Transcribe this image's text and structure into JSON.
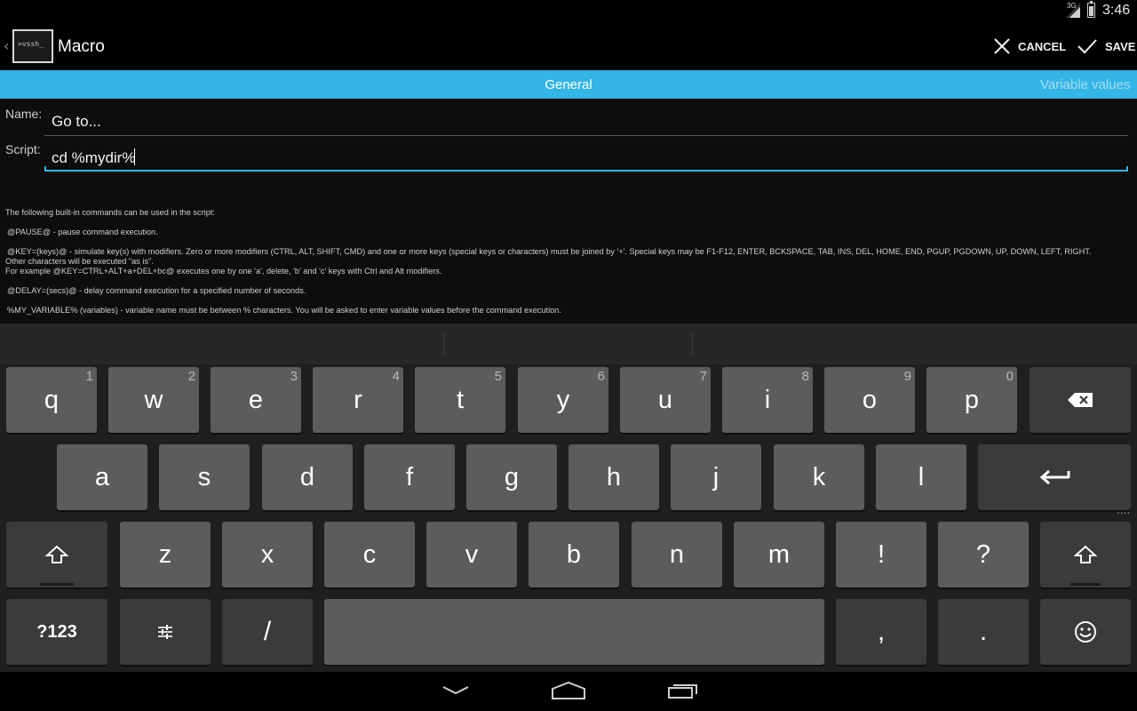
{
  "status_bar": {
    "network_label": "3G",
    "time": "3:46"
  },
  "action_bar": {
    "app_icon_text": ">vssh_",
    "title": "Macro",
    "cancel_label": "CANCEL",
    "save_label": "SAVE"
  },
  "tabs": {
    "general": "General",
    "variable_values": "Variable values"
  },
  "form": {
    "name_label": "Name:",
    "name_value": "Go to...",
    "script_label": "Script:",
    "script_value": "cd %mydir%"
  },
  "help": {
    "intro": "The following built-in commands can be used in the script:",
    "pause": "@PAUSE@ - pause command execution.",
    "key_line1": "@KEY=(keys)@ - simulate key(s) with modifiers. Zero or more modifiers (CTRL, ALT, SHIFT, CMD) and one or more keys (special keys or characters) must be joined by '+'. Special keys may be F1-F12, ENTER, BCKSPACE, TAB, INS, DEL, HOME, END, PGUP, PGDOWN, UP, DOWN, LEFT, RIGHT.",
    "key_line2": "Other characters will be executed \"as is\".",
    "key_line3": "For example @KEY=CTRL+ALT+a+DEL+bc@ executes one by one 'a', delete, 'b' and 'c' keys with Ctrl and Alt modifiers.",
    "delay": "@DELAY=(secs)@ - delay command execution for a specified number of seconds.",
    "variable": "%MY_VARIABLE% (variables) - variable name must be between % characters. You will be asked to enter variable values before the command execution."
  },
  "keyboard": {
    "row1": [
      {
        "label": "q",
        "hint": "1"
      },
      {
        "label": "w",
        "hint": "2"
      },
      {
        "label": "e",
        "hint": "3"
      },
      {
        "label": "r",
        "hint": "4"
      },
      {
        "label": "t",
        "hint": "5"
      },
      {
        "label": "y",
        "hint": "6"
      },
      {
        "label": "u",
        "hint": "7"
      },
      {
        "label": "i",
        "hint": "8"
      },
      {
        "label": "o",
        "hint": "9"
      },
      {
        "label": "p",
        "hint": "0"
      }
    ],
    "row2": [
      "a",
      "s",
      "d",
      "f",
      "g",
      "h",
      "j",
      "k",
      "l"
    ],
    "row3": [
      "z",
      "x",
      "c",
      "v",
      "b",
      "n",
      "m",
      "!",
      "?"
    ],
    "symbols_label": "?123",
    "slash_label": "/",
    "comma_label": ",",
    "period_label": ".",
    "more_indicator": "....",
    "icons": {
      "backspace": "backspace-icon",
      "enter": "enter-icon",
      "shift": "shift-icon",
      "settings": "settings-sliders-icon",
      "emoji": "emoji-icon"
    }
  },
  "nav_bar": {
    "icons": [
      "back-icon",
      "home-icon",
      "recent-apps-icon"
    ]
  },
  "colors": {
    "accent": "#33b5e5",
    "key_light": "#5b5c5e",
    "key_dark": "#3a3b3d",
    "keyboard_bg": "#1e1f20"
  }
}
